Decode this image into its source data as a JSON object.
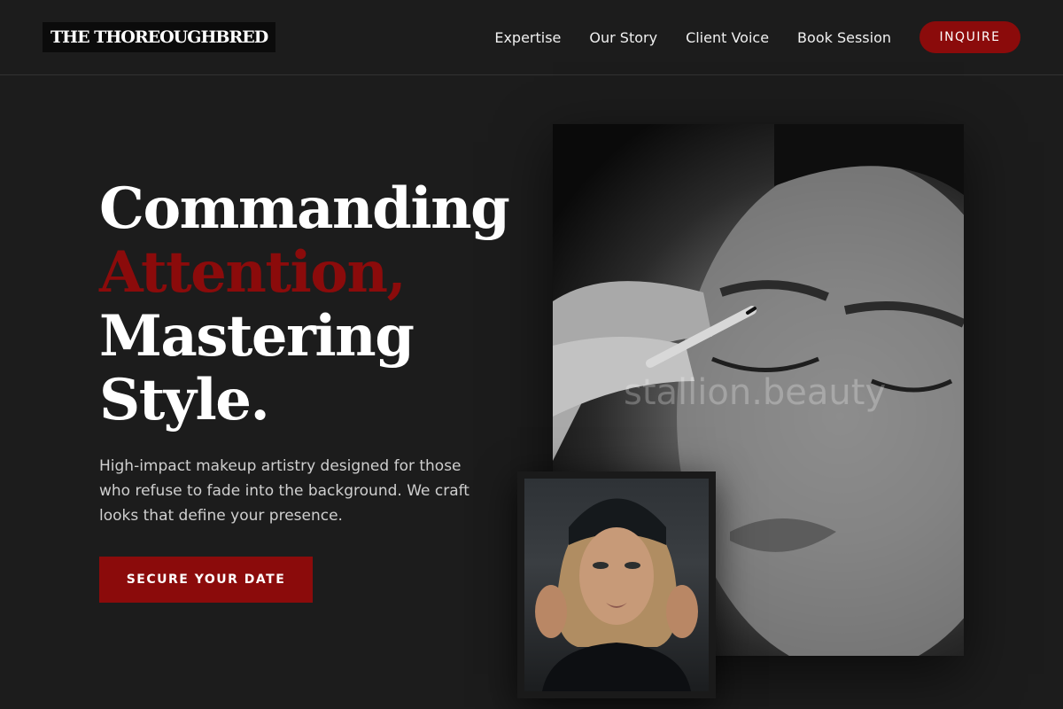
{
  "brand": {
    "logo_text": "THE THOREOUGHBRED"
  },
  "nav": {
    "links": [
      {
        "label": "Expertise"
      },
      {
        "label": "Our Story"
      },
      {
        "label": "Client Voice"
      },
      {
        "label": "Book Session"
      }
    ],
    "cta_label": "INQUIRE"
  },
  "hero": {
    "title_lines": [
      "Commanding",
      "Attention,",
      "Mastering",
      "Style."
    ],
    "subtitle": "High-impact makeup artistry designed for those who refuse to fade into the background. We craft looks that define your presence.",
    "cta_label": "SECURE YOUR DATE"
  },
  "images": {
    "main_watermark": "stallion.beauty"
  },
  "colors": {
    "background": "#1c1c1c",
    "accent": "#8b0b0b",
    "text": "#ffffff"
  }
}
